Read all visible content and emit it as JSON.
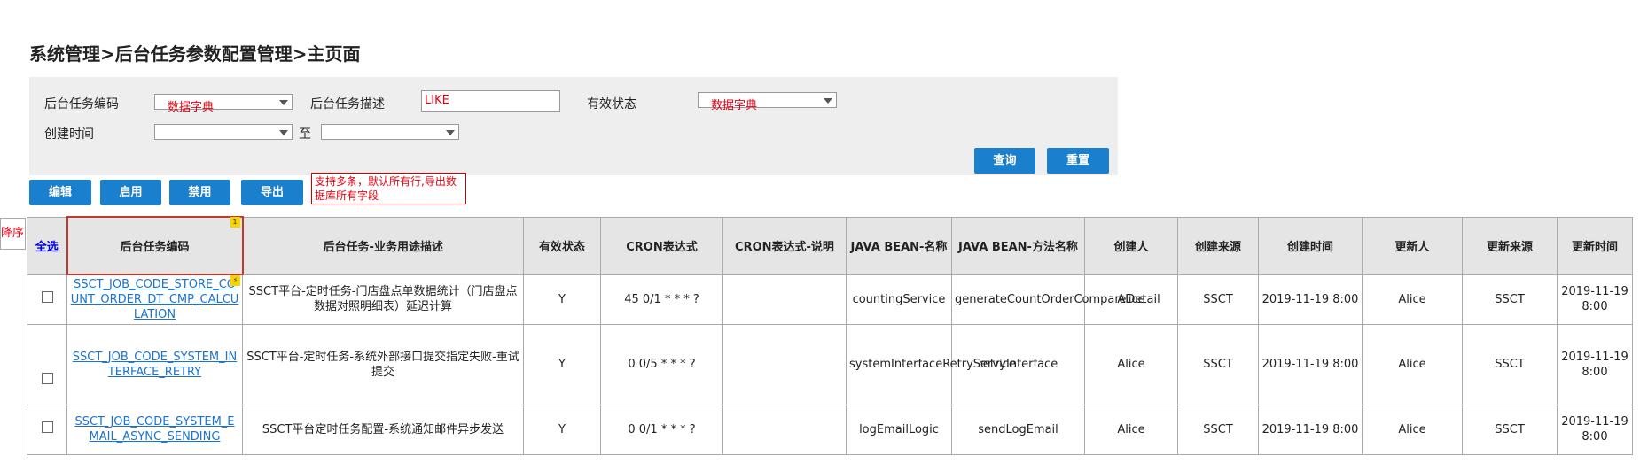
{
  "page_title": "系统管理>后台任务参数配置管理>主页面",
  "filters": {
    "task_code_label": "后台任务编码",
    "task_code_value": "数据字典",
    "task_desc_label": "后台任务描述",
    "task_desc_value": "LIKE",
    "status_label": "有效状态",
    "status_value": "数据字典",
    "created_label": "创建时间",
    "created_from": "",
    "to_label": "至",
    "created_to": "",
    "query_btn": "查询",
    "reset_btn": "重置"
  },
  "toolbar": {
    "edit": "编辑",
    "enable": "启用",
    "disable": "禁用",
    "export": "导出",
    "note": "支持多条，默认所有行,导出数据库所有字段"
  },
  "sort_tag": "降序",
  "table": {
    "select_all": "全选",
    "header_badge": "1",
    "headers": [
      "后台任务编码",
      "后台任务-业务用途描述",
      "有效状态",
      "CRON表达式",
      "CRON表达式-说明",
      "JAVA BEAN-名称",
      "JAVA BEAN-方法名称",
      "创建人",
      "创建来源",
      "创建时间",
      "更新人",
      "更新来源",
      "更新时间"
    ],
    "rows": [
      {
        "code": "SSCT_JOB_CODE_STORE_COUNT_ORDER_DT_CMP_CALCULATION",
        "badge": "⚡",
        "desc": "SSCT平台-定时任务-门店盘点单数据统计（门店盘点数据对照明细表）延迟计算",
        "status": "Y",
        "cron": "45 0/1 * * * ?",
        "cron_desc": "",
        "bean": "countingService",
        "method": "generateCountOrderCompareDetail",
        "creator": "Alice",
        "create_src": "SSCT",
        "create_time": "2019-11-19 8:00",
        "updater": "Alice",
        "update_src": "SSCT",
        "update_time": "2019-11-19 8:00"
      },
      {
        "code": "SSCT_JOB_CODE_SYSTEM_INTERFACE_RETRY",
        "desc": "SSCT平台-定时任务-系统外部接口提交指定失败-重试提交",
        "status": "Y",
        "cron": "0 0/5 * * * ?",
        "cron_desc": "",
        "bean": "systemInterfaceRetryService",
        "method": "retryInterface",
        "creator": "Alice",
        "create_src": "SSCT",
        "create_time": "2019-11-19 8:00",
        "updater": "Alice",
        "update_src": "SSCT",
        "update_time": "2019-11-19 8:00"
      },
      {
        "code": "SSCT_JOB_CODE_SYSTEM_EMAIL_ASYNC_SENDING",
        "desc": "SSCT平台定时任务配置-系统通知邮件异步发送",
        "status": "Y",
        "cron": "0 0/1 * * * ?",
        "cron_desc": "",
        "bean": "logEmailLogic",
        "method": "sendLogEmail",
        "creator": "Alice",
        "create_src": "SSCT",
        "create_time": "2019-11-19 8:00",
        "updater": "Alice",
        "update_src": "SSCT",
        "update_time": "2019-11-19 8:00"
      }
    ]
  }
}
